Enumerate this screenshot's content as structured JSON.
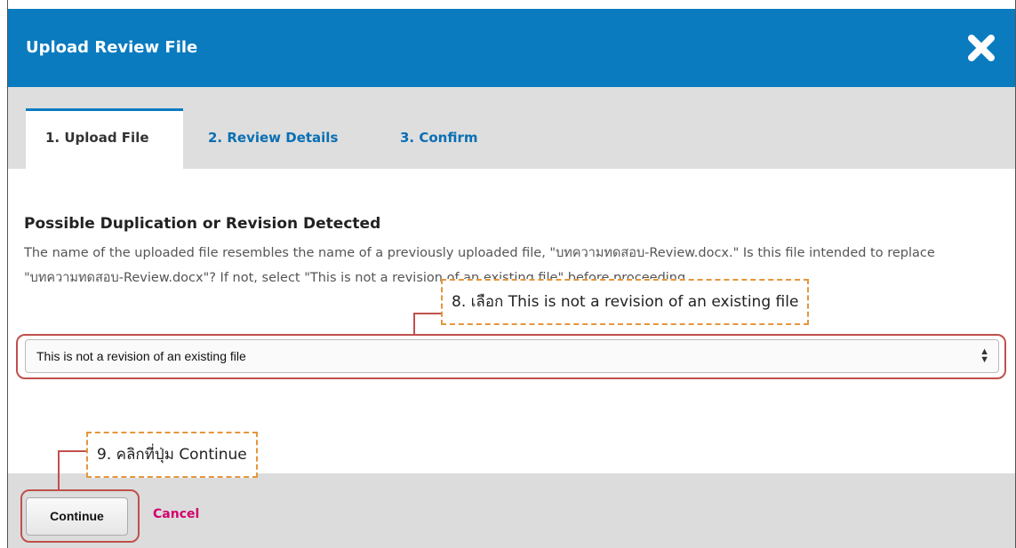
{
  "dialog": {
    "title": "Upload Review File",
    "close_icon": "close-icon"
  },
  "tabs": [
    {
      "label": "1. Upload File",
      "active": true
    },
    {
      "label": "2. Review Details",
      "active": false
    },
    {
      "label": "3. Confirm",
      "active": false
    }
  ],
  "notice": {
    "heading": "Possible Duplication or Revision Detected",
    "body": "The name of the uploaded file resembles the name of a previously uploaded file, \"บทความทดสอบ-Review.docx.\" Is this file intended to replace \"บทความทดสอบ-Review.docx\"? If not, select \"This is not a revision of an existing file\" before proceeding."
  },
  "revision_select": {
    "selected": "This is not a revision of an existing file"
  },
  "footer": {
    "continue_label": "Continue",
    "cancel_label": "Cancel"
  },
  "annotations": {
    "step8": "8. เลือก This is not a revision of an existing file",
    "step9": "9. คลิกที่ปุ่ม Continue"
  },
  "colors": {
    "header": "#0a7bbf",
    "tab_link": "#0a6fb3",
    "cancel": "#d2006e",
    "highlight": "#c0504d",
    "callout_border": "#e5963d"
  }
}
